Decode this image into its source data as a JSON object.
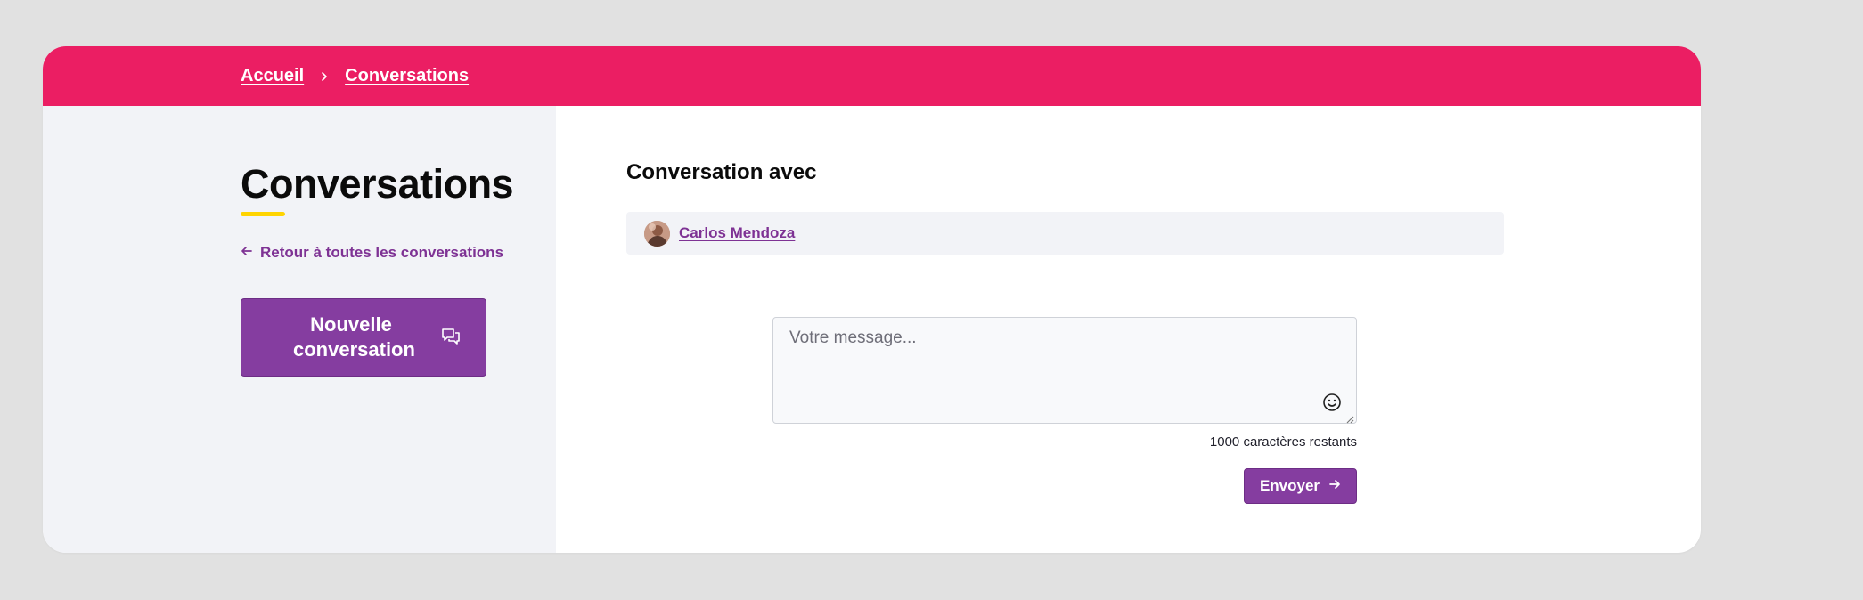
{
  "breadcrumb": {
    "home": "Accueil",
    "current": "Conversations"
  },
  "sidebar": {
    "title": "Conversations",
    "back_link": "Retour à toutes les conversations",
    "new_conversation_label": "Nouvelle conversation"
  },
  "main": {
    "heading": "Conversation avec",
    "participant": {
      "name": "Carlos Mendoza"
    },
    "message": {
      "placeholder": "Votre message...",
      "value": ""
    },
    "char_count": "1000 caractères restants",
    "send_label": "Envoyer"
  },
  "colors": {
    "topbar": "#eb1e63",
    "accent": "#853da0",
    "link": "#7e3294",
    "underline": "#ffd400",
    "panel": "#f2f3f7"
  },
  "icons": {
    "breadcrumb_sep": "chevron-right-icon",
    "back": "arrow-left-icon",
    "new_conversation": "chat-bubbles-icon",
    "emoji": "smiley-icon",
    "send": "arrow-right-icon"
  }
}
